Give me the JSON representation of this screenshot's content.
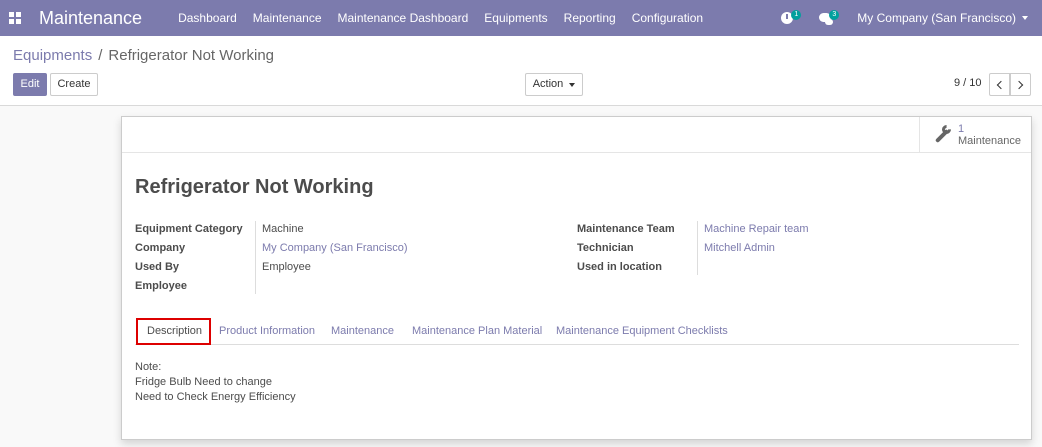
{
  "navbar": {
    "brand": "Maintenance",
    "menu": [
      "Dashboard",
      "Maintenance",
      "Maintenance Dashboard",
      "Equipments",
      "Reporting",
      "Configuration"
    ],
    "activity_count": "1",
    "message_count": "3",
    "company": "My Company (San Francisco)"
  },
  "breadcrumb": {
    "parent": "Equipments",
    "separator": "/",
    "current": "Refrigerator Not Working"
  },
  "buttons": {
    "edit": "Edit",
    "create": "Create",
    "action": "Action"
  },
  "pager": {
    "text": "9 / 10"
  },
  "stat": {
    "value": "1",
    "label": "Maintenance"
  },
  "record": {
    "title": "Refrigerator Not Working",
    "left_fields": [
      {
        "label": "Equipment Category",
        "value": "Machine",
        "link": false
      },
      {
        "label": "Company",
        "value": "My Company (San Francisco)",
        "link": true
      },
      {
        "label": "Used By",
        "value": "Employee",
        "link": false
      },
      {
        "label": "Employee",
        "value": "",
        "link": false
      }
    ],
    "right_fields": [
      {
        "label": "Maintenance Team",
        "value": "Machine Repair team",
        "link": true
      },
      {
        "label": "Technician",
        "value": "Mitchell Admin",
        "link": true
      },
      {
        "label": "Used in location",
        "value": "",
        "link": false
      }
    ]
  },
  "tabs": [
    "Description",
    "Product Information",
    "Maintenance",
    "Maintenance Plan Material",
    "Maintenance Equipment Checklists"
  ],
  "description": {
    "lines": [
      "Note:",
      "Fridge Bulb Need to change",
      "Need to Check Energy Efficiency"
    ]
  },
  "colors": {
    "brand": "#7c7bad",
    "badge": "#00a09d",
    "highlight": "#dd0000"
  }
}
